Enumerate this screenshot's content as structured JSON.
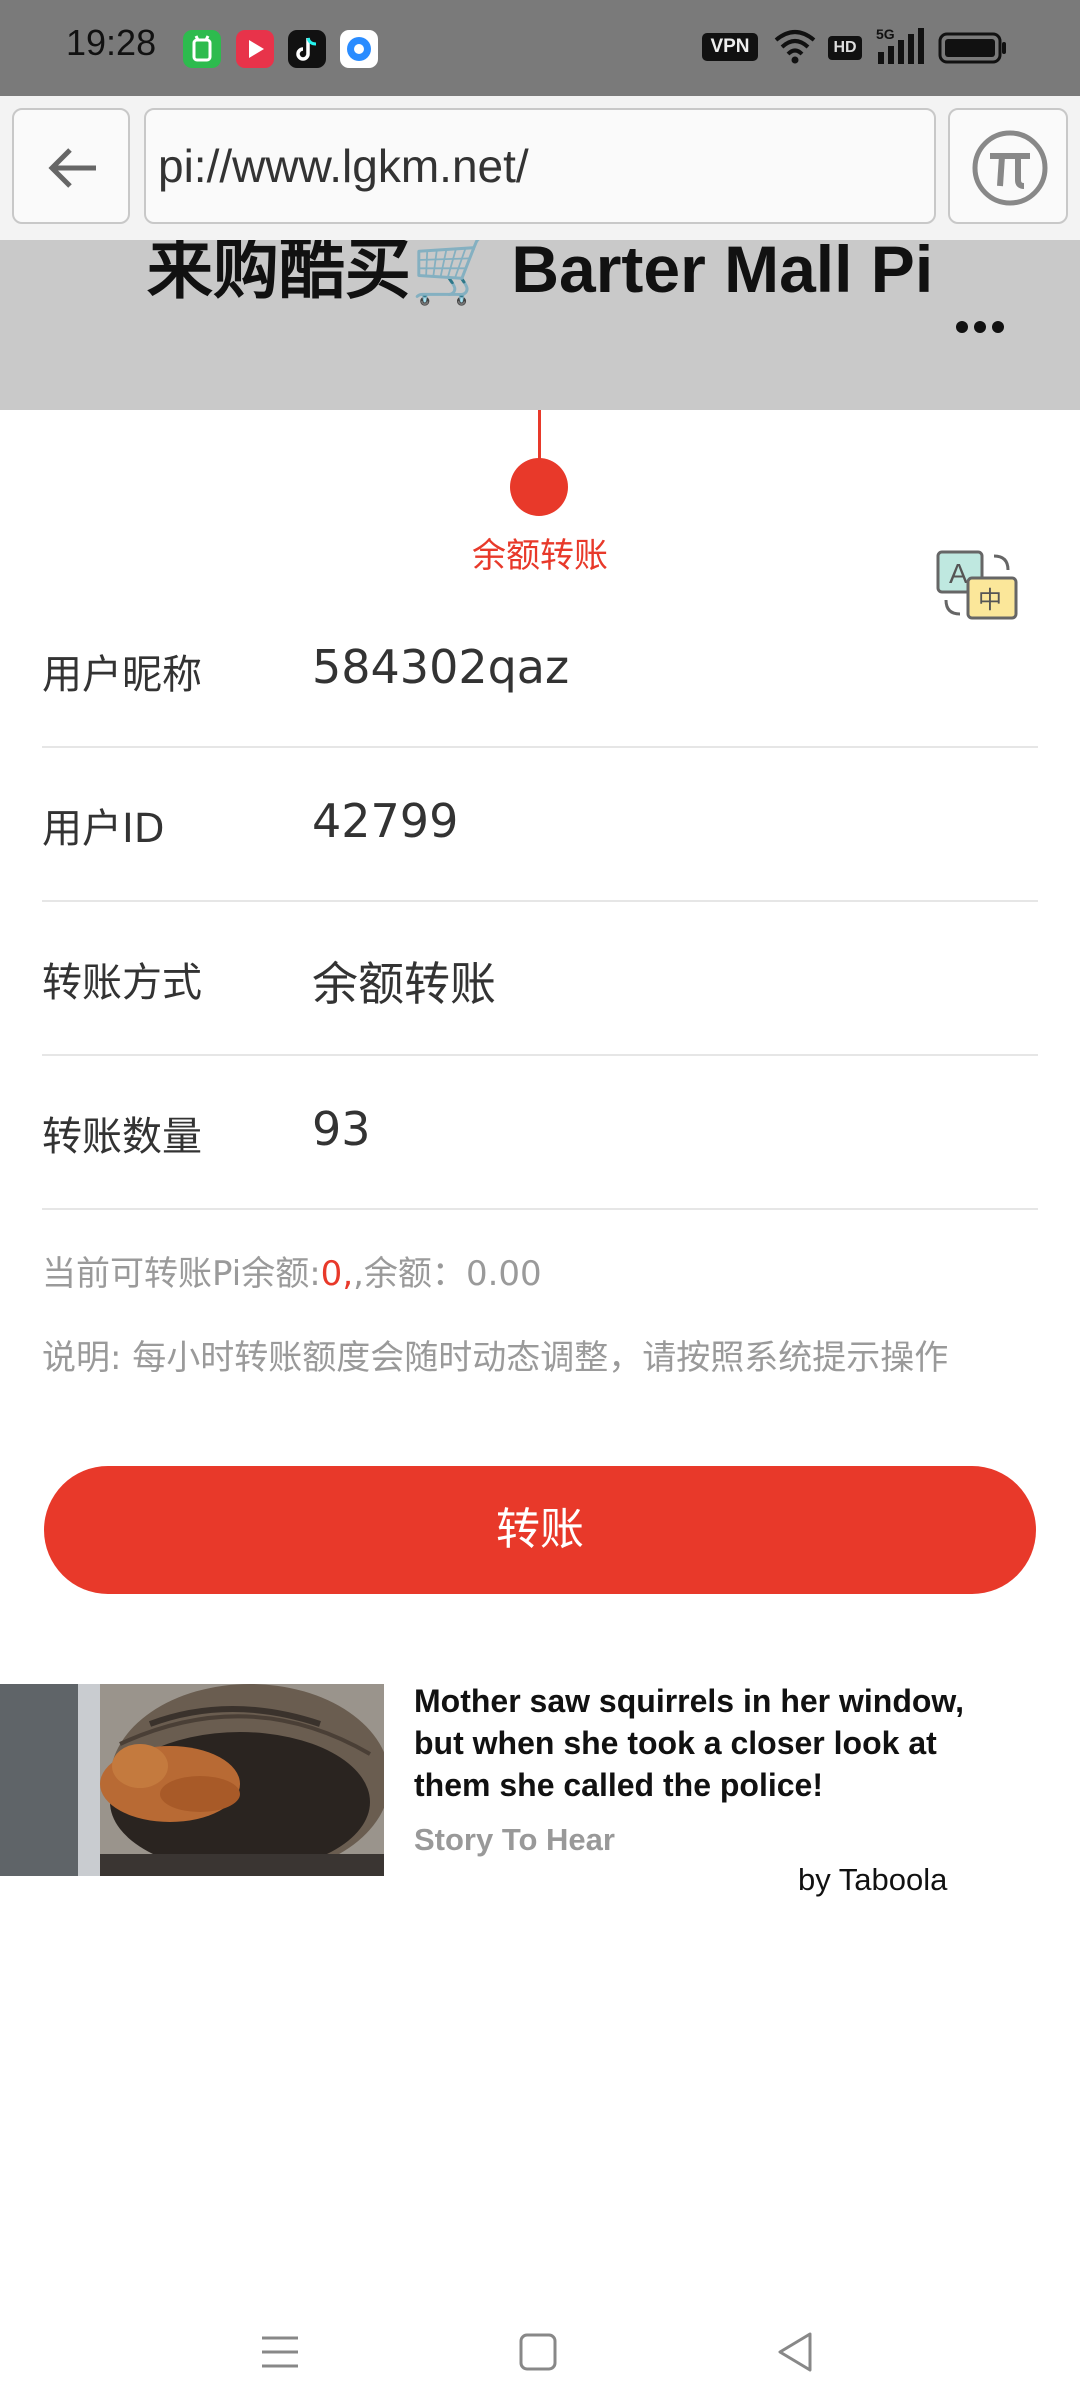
{
  "status_bar": {
    "time": "19:28",
    "apps": [
      "app-store-icon",
      "video-app-icon",
      "tiktok-icon",
      "browser-app-icon"
    ],
    "vpn_label": "VPN",
    "hd_label": "HD",
    "network_label": "5G"
  },
  "browser": {
    "url": "pi://www.lgkm.net/"
  },
  "header": {
    "title": "来购酷买🛒 Barter Mall Pi"
  },
  "step": {
    "label": "余额转账"
  },
  "form": {
    "rows": [
      {
        "label": "用户昵称",
        "value": "584302qaz"
      },
      {
        "label": "用户ID",
        "value": "42799"
      },
      {
        "label": "转账方式",
        "value": "余额转账"
      },
      {
        "label": "转账数量",
        "value": "93"
      }
    ]
  },
  "balance": {
    "prefix": "当前可转账Pi余额:",
    "pi_amount": "0",
    "separator": ",余额：",
    "amount": "0.00"
  },
  "note": "说明: 每小时转账额度会随时动态调整，请按照系统提示操作",
  "transfer_button": "转账",
  "ad": {
    "title": "Mother saw squirrels in her window, but when she took a closer look at them she called the police!",
    "source": "Story To Hear",
    "attribution": "by Taboola"
  },
  "colors": {
    "accent": "#e8392a",
    "header_bg": "#c9c9c9",
    "status_bg": "#7a7a7a"
  }
}
